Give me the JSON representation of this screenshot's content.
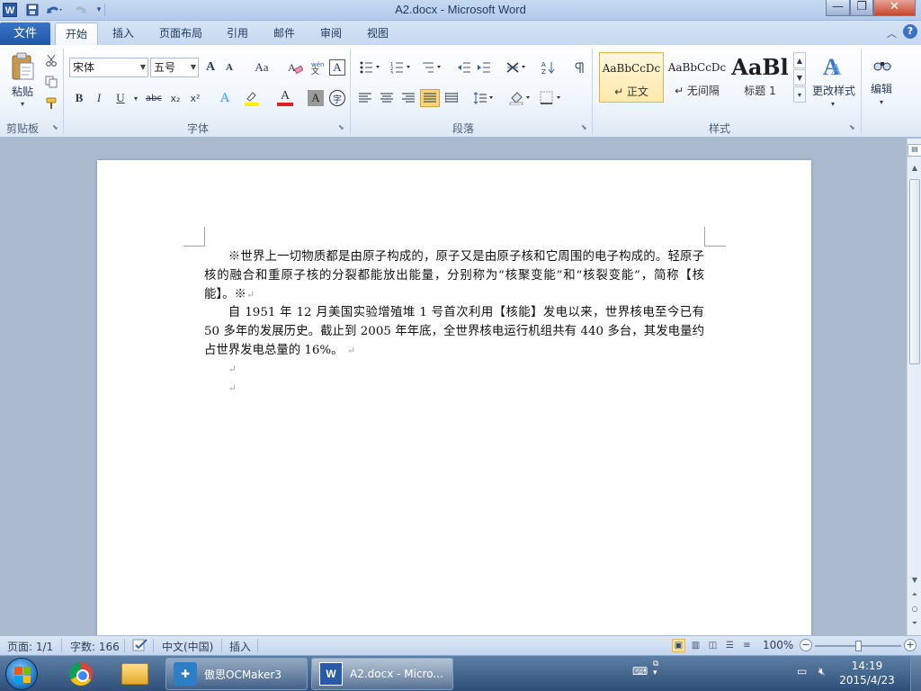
{
  "window": {
    "title": "A2.docx - Microsoft Word",
    "app_icon": "W",
    "minimize_glyph": "—",
    "maximize_glyph": "❐",
    "close_glyph": "✕"
  },
  "quick_access": {
    "icons": [
      "save-icon",
      "undo-icon",
      "redo-icon",
      "customize-qat-icon"
    ]
  },
  "tabs": {
    "file": "文件",
    "items": [
      "开始",
      "插入",
      "页面布局",
      "引用",
      "邮件",
      "审阅",
      "视图"
    ],
    "active": "开始"
  },
  "ribbon": {
    "clipboard": {
      "paste_label": "粘贴",
      "group_label": "剪贴板"
    },
    "font": {
      "font_name": "宋体",
      "font_size": "五号",
      "grow_font": "A",
      "shrink_font": "A",
      "change_case": "Aa",
      "clear_format": "A",
      "bold": "B",
      "italic": "I",
      "underline": "U",
      "strikethrough": "abc",
      "subscript": "x₂",
      "superscript": "x²",
      "text_effect": "A",
      "font_color": "A",
      "char_shading": "A",
      "enclose": "字",
      "group_label": "字体"
    },
    "paragraph": {
      "group_label": "段落"
    },
    "styles": {
      "items": [
        {
          "sample": "AaBbCcDc",
          "name": "↵ 正文"
        },
        {
          "sample": "AaBbCcDc",
          "name": "↵ 无间隔"
        },
        {
          "sample": "AaBl",
          "name": "标题 1"
        }
      ],
      "change_styles": "更改样式",
      "group_label": "样式"
    },
    "editing": {
      "label": "编辑"
    }
  },
  "document": {
    "paragraphs": [
      "※世界上一切物质都是由原子构成的，原子又是由原子核和它周围的电子构成的。轻原子核的融合和重原子核的分裂都能放出能量，分别称为“核聚变能”和“核裂变能”，简称【核能】。※",
      "自 1951 年 12 月美国实验增殖堆 1 号首次利用【核能】发电以来，世界核电至今已有 50 多年的发展历史。截止到 2005 年年底，全世界核电运行机组共有 440 多台，其发电量约占世界发电总量的 16%。"
    ],
    "para_mark": "↵"
  },
  "status": {
    "page": "页面: 1/1",
    "word_count": "字数: 166",
    "language": "中文(中国)",
    "mode": "插入",
    "zoom": "100%",
    "zoom_percent": 100
  },
  "taskbar": {
    "tasks": [
      {
        "label": "傲思OCMaker3"
      },
      {
        "label": "A2.docx - Micro..."
      }
    ],
    "time": "14:19",
    "date": "2015/4/23"
  },
  "colors": {
    "file_tab": "#2a63b8",
    "title_bar": "#c7d9f1",
    "taskbar": "#3f5f88"
  }
}
